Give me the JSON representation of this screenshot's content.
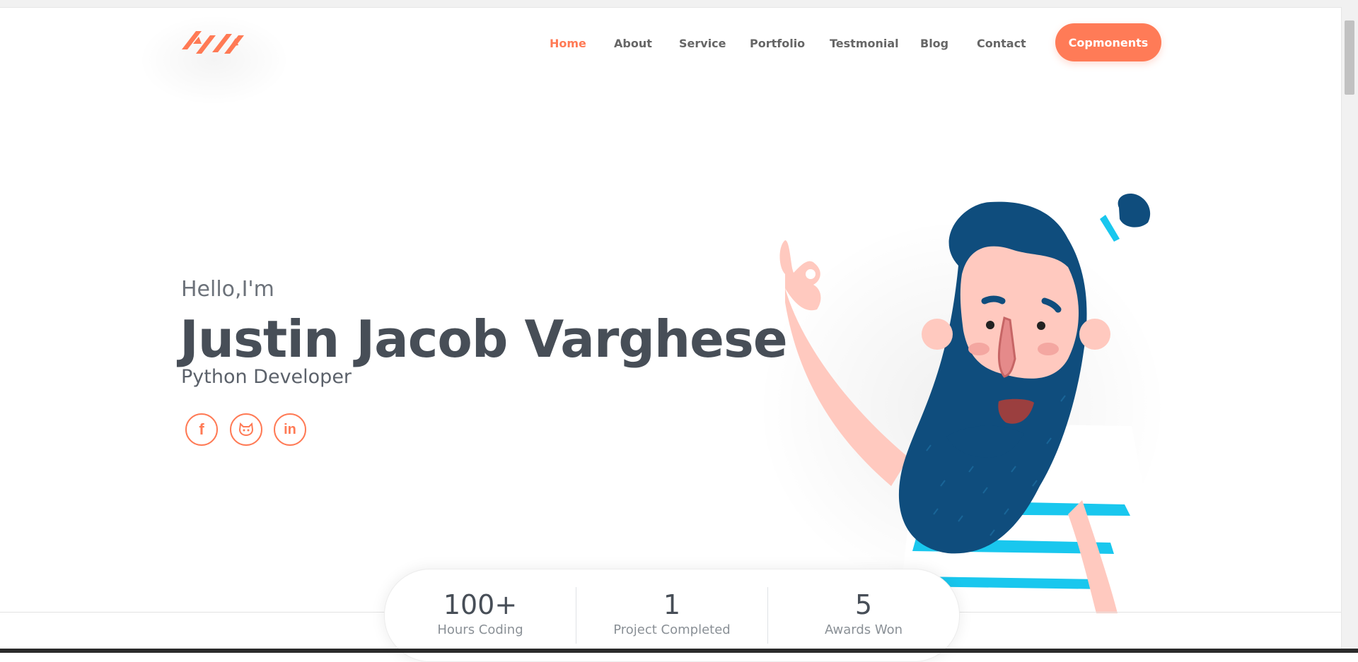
{
  "nav": {
    "items": [
      {
        "label": "Home",
        "active": true
      },
      {
        "label": "About",
        "active": false
      },
      {
        "label": "Service",
        "active": false
      },
      {
        "label": "Portfolio",
        "active": false
      },
      {
        "label": "Testmonial",
        "active": false
      },
      {
        "label": "Blog",
        "active": false
      },
      {
        "label": "Contact",
        "active": false
      }
    ],
    "cta_label": "Copmonents"
  },
  "hero": {
    "greeting": "Hello,I'm",
    "name": "Justin Jacob Varghese",
    "role": "Python Developer"
  },
  "social": {
    "icons": [
      "facebook-icon",
      "github-icon",
      "linkedin-icon"
    ],
    "facebook_glyph": "f",
    "linkedin_glyph": "in"
  },
  "stats": [
    {
      "value": "100+",
      "label": "Hours Coding"
    },
    {
      "value": "1",
      "label": "Project Completed"
    },
    {
      "value": "5",
      "label": "Awards Won"
    }
  ],
  "colors": {
    "accent": "#ff7a55",
    "text_dark": "#474e57",
    "beard": "#0f4d7d",
    "skin": "#ffc9bf",
    "stripe": "#19c7ee"
  }
}
